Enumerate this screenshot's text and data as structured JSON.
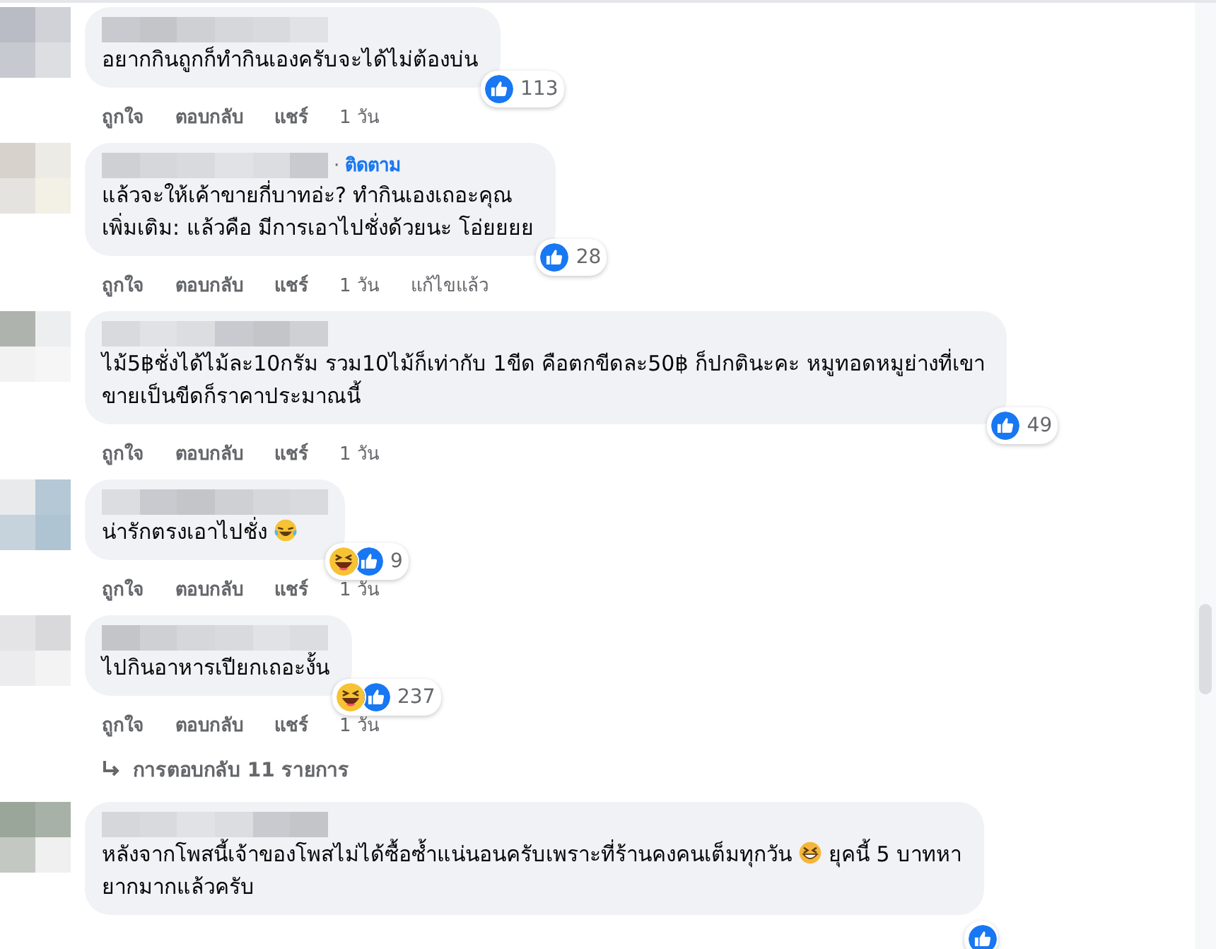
{
  "comments": [
    {
      "lines": [
        [
          {
            "kind": "text",
            "text": "อยากกินถูกก็ทำกินเองครับจะได้ไม่ต้องบ่น"
          }
        ]
      ],
      "reactions": [
        {
          "kind": "like"
        }
      ],
      "count": "113",
      "actions": [
        "ถูกใจ",
        "ตอบกลับ",
        "แชร์",
        "1 วัน"
      ]
    },
    {
      "follow": {
        "separator": "·",
        "label": "ติดตาม"
      },
      "lines": [
        [
          {
            "kind": "text",
            "text": "แล้วจะให้เค้าขายกี่บาทอ่ะ? ทำกินเองเถอะคุณ"
          }
        ],
        [
          {
            "kind": "text",
            "text": "เพิ่มเติม: แล้วคือ มีการเอาไปชั่งด้วยนะ โอ่ยยยย"
          }
        ]
      ],
      "reactions": [
        {
          "kind": "like"
        }
      ],
      "count": "28",
      "actions": [
        "ถูกใจ",
        "ตอบกลับ",
        "แชร์",
        "1 วัน",
        "แก้ไขแล้ว"
      ]
    },
    {
      "lines": [
        [
          {
            "kind": "text",
            "text": "ไม้5฿ชั่งได้ไม้ละ10กรัม รวม10ไม้ก็เท่ากับ 1ขีด คือตกขีดละ50฿ ก็ปกตินะคะ หมูทอดหมูย่างที่เขา"
          }
        ],
        [
          {
            "kind": "text",
            "text": "ขายเป็นขีดก็ราคาประมาณนี้"
          }
        ]
      ],
      "reactions": [
        {
          "kind": "like"
        }
      ],
      "count": "49",
      "actions": [
        "ถูกใจ",
        "ตอบกลับ",
        "แชร์",
        "1 วัน"
      ]
    },
    {
      "lines": [
        [
          {
            "kind": "text",
            "text": "น่ารักตรงเอาไปชั่ง"
          },
          {
            "kind": "tears-emoji"
          }
        ]
      ],
      "reactions": [
        {
          "kind": "haha"
        },
        {
          "kind": "like"
        }
      ],
      "count": "9",
      "actions": [
        "ถูกใจ",
        "ตอบกลับ",
        "แชร์",
        "1 วัน"
      ]
    },
    {
      "lines": [
        [
          {
            "kind": "text",
            "text": "ไปกินอาหารเปียกเถอะงั้น"
          }
        ]
      ],
      "reactions": [
        {
          "kind": "haha"
        },
        {
          "kind": "like"
        }
      ],
      "count": "237",
      "actions": [
        "ถูกใจ",
        "ตอบกลับ",
        "แชร์",
        "1 วัน"
      ],
      "replies": "การตอบกลับ 11 รายการ"
    },
    {
      "lines": [
        [
          {
            "kind": "text",
            "text": "หลังจากโพสนี้เจ้าของโพสไม่ได้ซื้อซ้ำแน่นอนครับเพราะที่ร้านคงคนเต็มทุกวัน"
          },
          {
            "kind": "grin-emoji"
          },
          {
            "kind": "text",
            "text": "ยุคนี้ 5 บาทหา"
          }
        ],
        [
          {
            "kind": "text",
            "text": "ยากมากแล้วครับ"
          }
        ]
      ],
      "reactions": [
        {
          "kind": "like"
        }
      ]
    }
  ]
}
